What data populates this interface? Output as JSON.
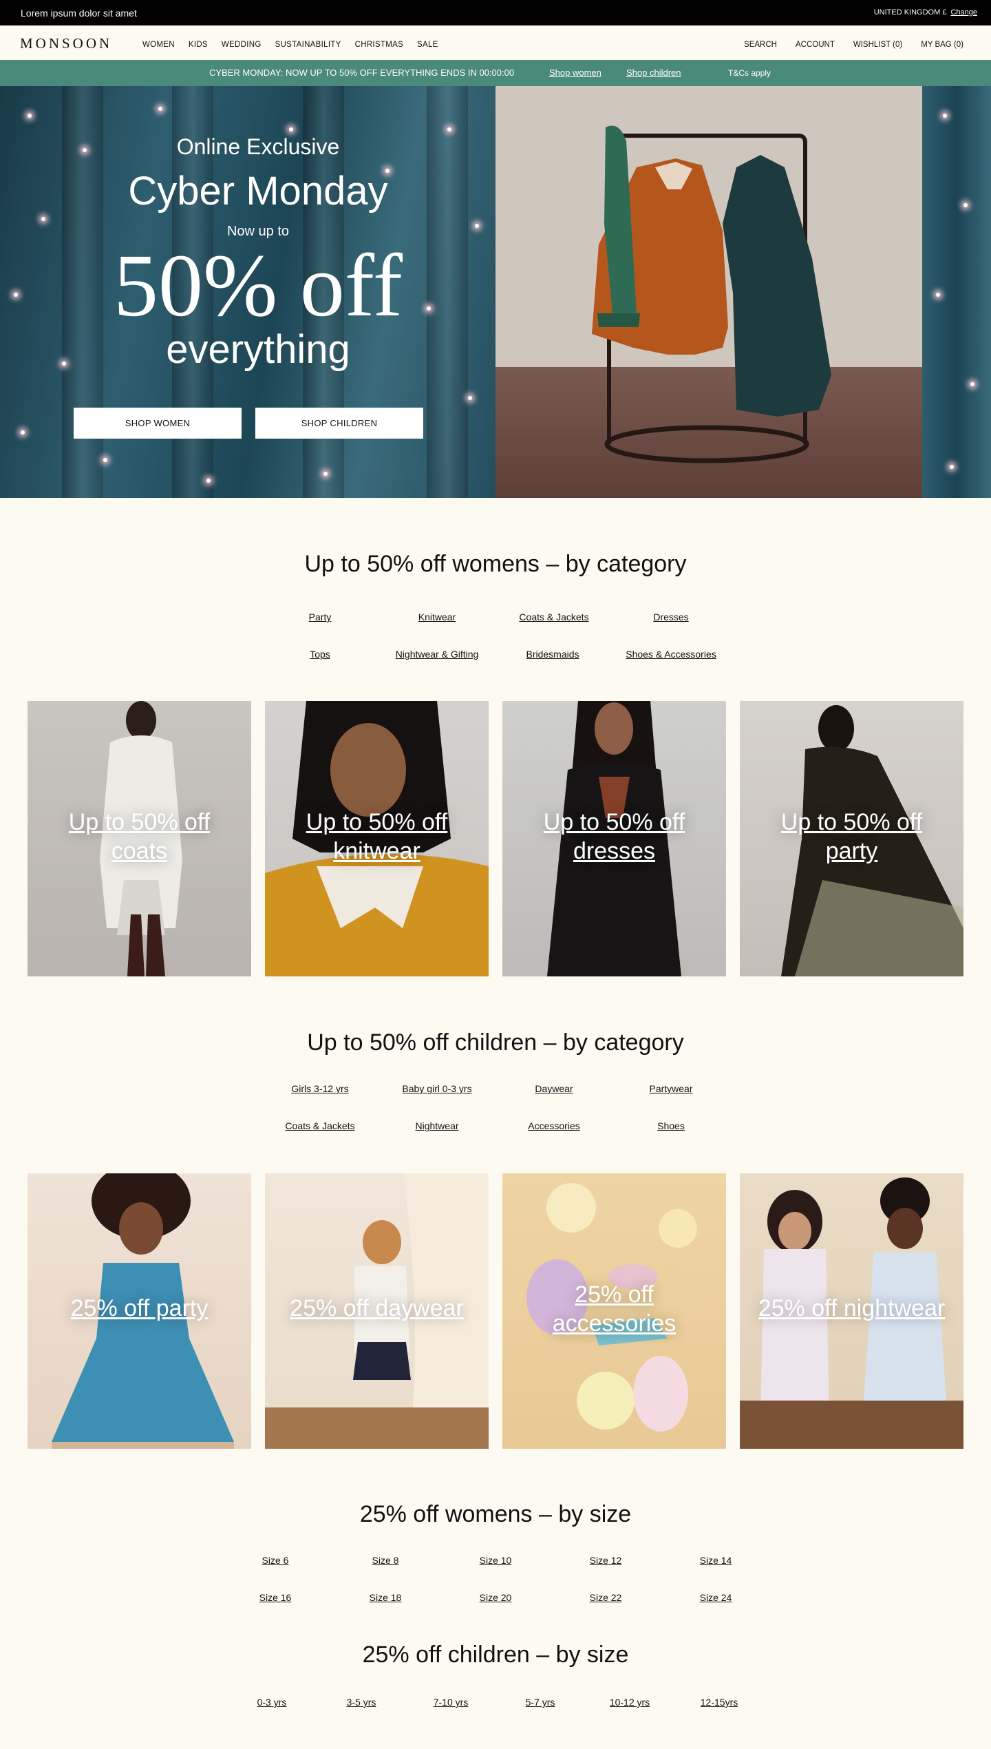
{
  "topbar": {
    "message": "Lorem ipsum dolor sit amet",
    "region": "UNITED KINGDOM £",
    "change": "Change"
  },
  "header": {
    "logo": "MONSOON",
    "nav": [
      "WOMEN",
      "KIDS",
      "WEDDING",
      "SUSTAINABILITY",
      "CHRISTMAS",
      "SALE"
    ],
    "user_nav": [
      "SEARCH",
      "ACCOUNT",
      "WISHLIST (0)",
      "MY BAG (0)"
    ]
  },
  "promo": {
    "text": "CYBER MONDAY: NOW UP TO 50% OFF EVERYTHING ENDS IN 00:00:00",
    "link_women": "Shop women",
    "link_children": "Shop children",
    "tcs": "T&Cs apply"
  },
  "hero": {
    "line1": "Online Exclusive",
    "line2": "Cyber Monday",
    "line3": "Now up to",
    "line4": "50% off",
    "line5": "everything",
    "btn_women": "SHOP WOMEN",
    "btn_children": "SHOP CHILDREN"
  },
  "womens_category": {
    "title": "Up to 50% off womens – by category",
    "links": [
      "Party",
      "Knitwear",
      "Coats & Jackets",
      "Dresses",
      "Tops",
      "Nightwear & Gifting",
      "Bridesmaids",
      "Shoes & Accessories"
    ],
    "tiles": [
      {
        "line1": "Up to 50% off",
        "line2": "coats"
      },
      {
        "line1": "Up to 50% off",
        "line2": "knitwear"
      },
      {
        "line1": "Up to 50% off",
        "line2": "dresses"
      },
      {
        "line1": "Up to 50% off",
        "line2": "party"
      }
    ]
  },
  "children_category": {
    "title": "Up to 50% off children – by category",
    "links": [
      "Girls 3-12 yrs",
      "Baby girl 0-3 yrs",
      "Daywear",
      "Partywear",
      "Coats & Jackets",
      "Nightwear",
      "Accessories",
      "Shoes"
    ],
    "tiles": [
      {
        "line1": "25% off party",
        "line2": ""
      },
      {
        "line1": "25% off daywear",
        "line2": ""
      },
      {
        "line1": "25% off",
        "line2": "accessories"
      },
      {
        "line1": "25% off nightwear",
        "line2": ""
      }
    ]
  },
  "womens_size": {
    "title": "25% off womens – by size",
    "links": [
      "Size 6",
      "Size 8",
      "Size 10",
      "Size 12",
      "Size 14",
      "Size 16",
      "Size 18",
      "Size 20",
      "Size 22",
      "Size 24"
    ]
  },
  "children_size": {
    "title": "25% off children – by size",
    "links": [
      "0-3 yrs",
      "3-5 yrs",
      "7-10 yrs",
      "5-7 yrs",
      "10-12 yrs",
      "12-15yrs"
    ]
  },
  "colors": {
    "promo_bg": "#4a8a7a",
    "page_bg": "#fdfaf2",
    "topbar_bg": "#000000"
  }
}
